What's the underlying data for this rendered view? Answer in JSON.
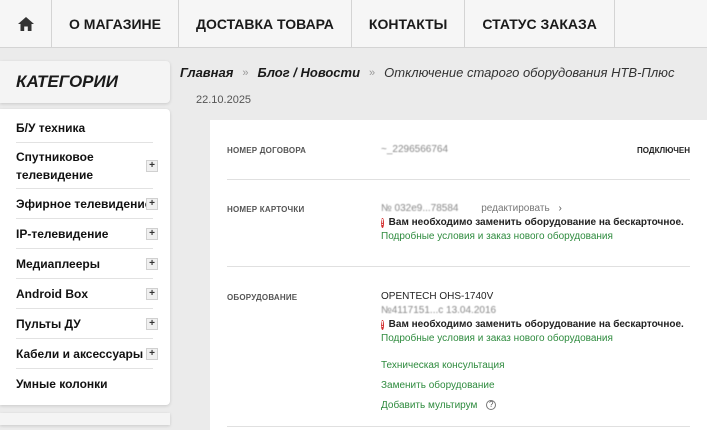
{
  "nav": {
    "items": [
      "О МАГАЗИНЕ",
      "ДОСТАВКА ТОВАРА",
      "КОНТАКТЫ",
      "СТАТУС ЗАКАЗА"
    ]
  },
  "sidebar": {
    "title": "КАТЕГОРИИ",
    "items": [
      {
        "label": "Б/У техника",
        "expandable": false
      },
      {
        "label": "Спутниковое телевидение",
        "expandable": true
      },
      {
        "label": "Эфирное телевидение",
        "expandable": true
      },
      {
        "label": "IP-телевидение",
        "expandable": true
      },
      {
        "label": "Медиаплееры",
        "expandable": true
      },
      {
        "label": "Android Box",
        "expandable": true
      },
      {
        "label": "Пульты ДУ",
        "expandable": true
      },
      {
        "label": "Кабели и аксессуары",
        "expandable": true
      },
      {
        "label": "Умные колонки",
        "expandable": false
      }
    ],
    "plus": "+"
  },
  "breadcrumb": {
    "home": "Главная",
    "blog": "Блог / Новости",
    "current": "Отключение старого оборудования НТВ-Плюс",
    "sep": "»"
  },
  "date": "22.10.2025",
  "contract": {
    "label": "НОМЕР ДОГОВОРА",
    "value": "~_2296566764",
    "status": "ПОДКЛЮЧЕН"
  },
  "card_section": {
    "label": "НОМЕР КАРТОЧКИ",
    "number": "№ 032е9...78584",
    "edit": "редактировать",
    "edit_arrow": "›",
    "warning": "Вам необходимо заменить оборудование на бескарточное.",
    "link": "Подробные условия и заказ нового оборудования"
  },
  "equipment": {
    "label": "ОБОРУДОВАНИЕ",
    "model": "OPENTECH OHS-1740V",
    "serial": "№4117151...с 13.04.2016",
    "warning": "Вам необходимо заменить оборудование на бескарточное.",
    "link": "Подробные условия и заказ нового оборудования",
    "actions": [
      "Техническая консультация",
      "Заменить оборудование",
      "Добавить мультирум"
    ],
    "help": "?"
  },
  "warn_icon": "!",
  "colors": {
    "green": "#2e8b3e",
    "warning_red": "#d32f2f"
  }
}
